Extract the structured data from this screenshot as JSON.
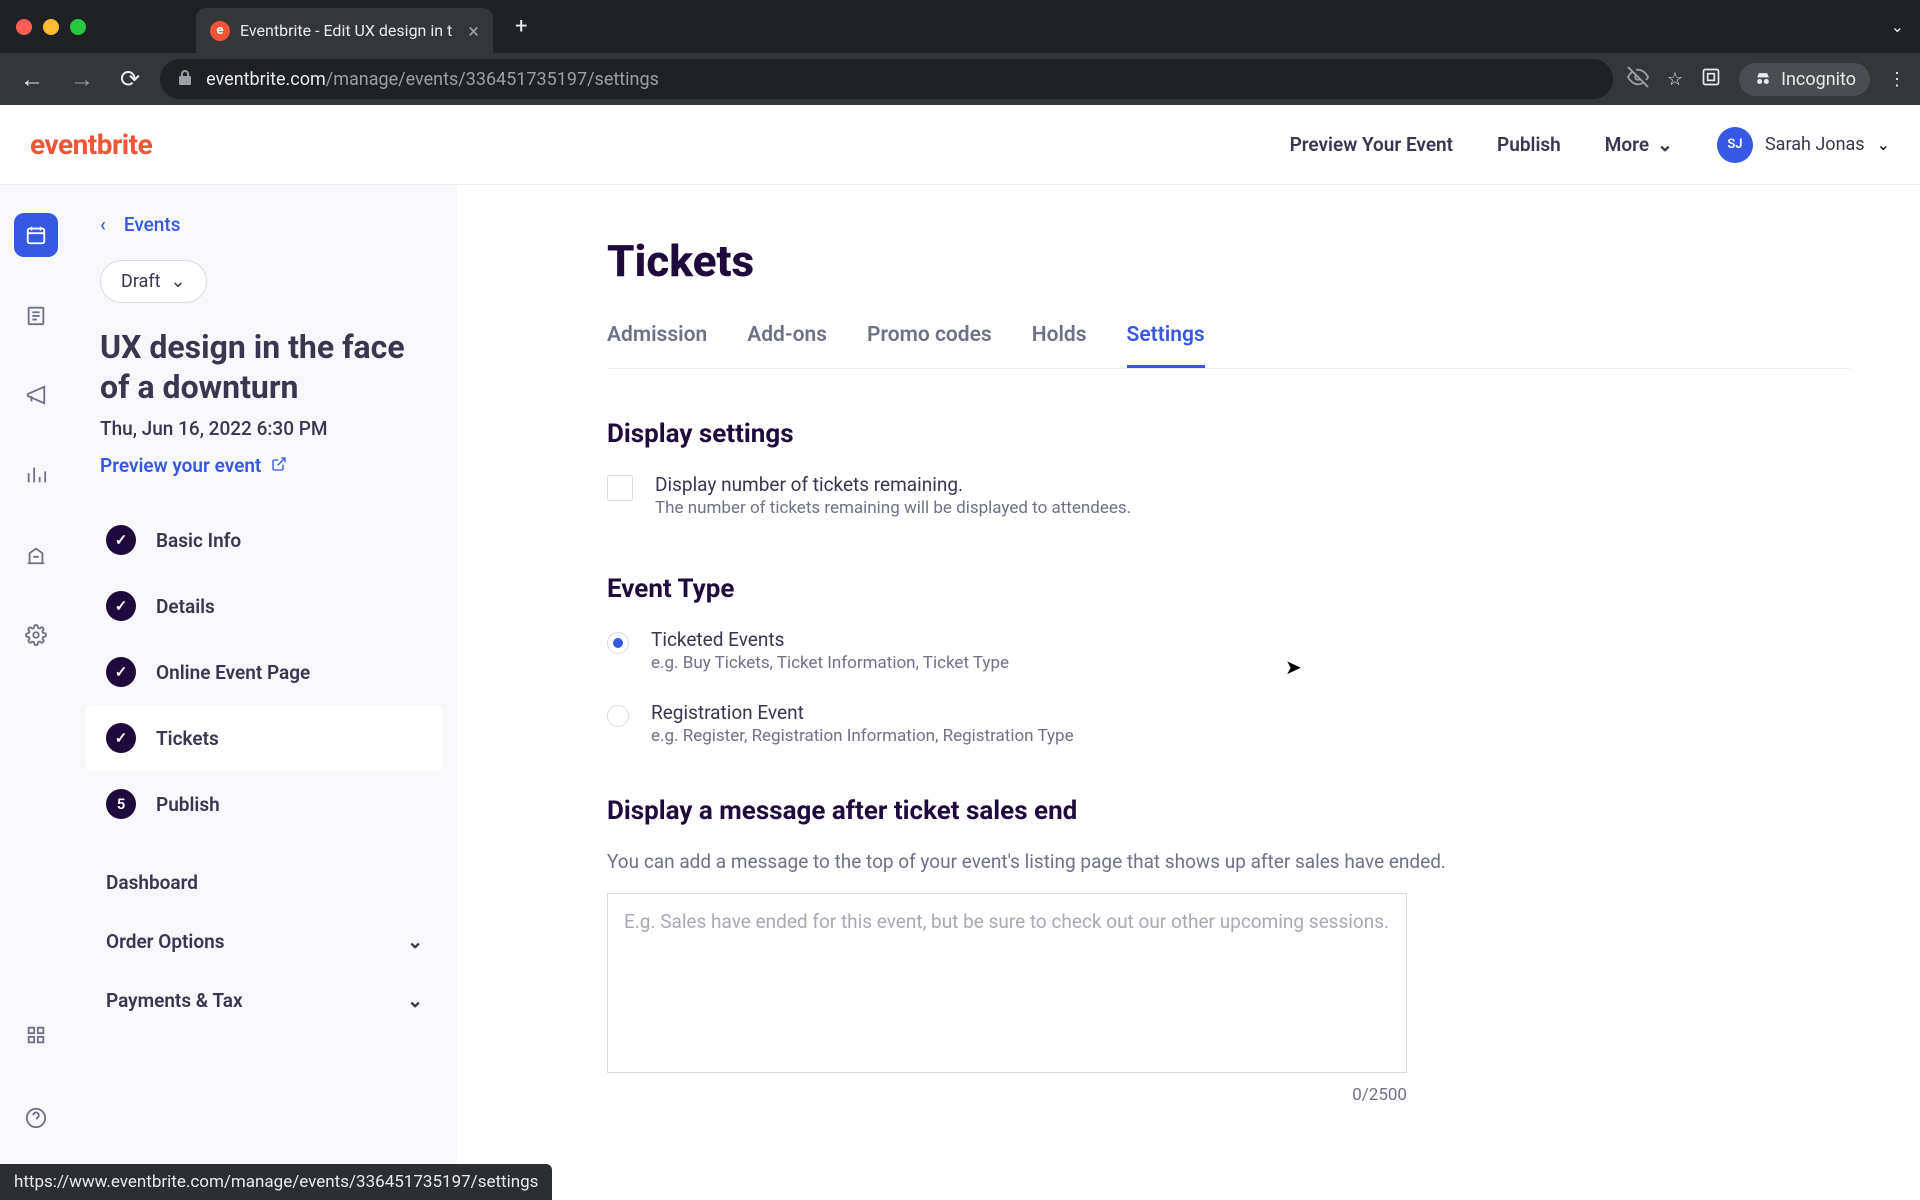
{
  "browser": {
    "tab_title": "Eventbrite - Edit UX design in t",
    "url_host": "eventbrite.com",
    "url_path": "/manage/events/336451735197/settings",
    "incognito_label": "Incognito"
  },
  "header": {
    "logo": "eventbrite",
    "preview_event": "Preview Your Event",
    "publish": "Publish",
    "more": "More",
    "user_initials": "SJ",
    "user_name": "Sarah Jonas"
  },
  "sidebar": {
    "back_label": "Events",
    "status_pill": "Draft",
    "event_title": "UX design in the face of a downturn",
    "event_date": "Thu, Jun 16, 2022 6:30 PM",
    "preview_link": "Preview your event",
    "steps": [
      {
        "label": "Basic Info",
        "done": true
      },
      {
        "label": "Details",
        "done": true
      },
      {
        "label": "Online Event Page",
        "done": true
      },
      {
        "label": "Tickets",
        "done": true,
        "active": true
      },
      {
        "label": "Publish",
        "num": "5"
      }
    ],
    "links": {
      "dashboard": "Dashboard",
      "order_options": "Order Options",
      "payments_tax": "Payments & Tax"
    }
  },
  "content": {
    "title": "Tickets",
    "tabs": {
      "admission": "Admission",
      "addons": "Add-ons",
      "promo": "Promo codes",
      "holds": "Holds",
      "settings": "Settings"
    },
    "display_settings_title": "Display settings",
    "display_remaining_label": "Display number of tickets remaining.",
    "display_remaining_sub": "The number of tickets remaining will be displayed to attendees.",
    "event_type_title": "Event Type",
    "ticketed_label": "Ticketed Events",
    "ticketed_sub": "e.g. Buy Tickets, Ticket Information, Ticket Type",
    "registration_label": "Registration Event",
    "registration_sub": "e.g. Register, Registration Information, Registration Type",
    "message_title": "Display a message after ticket sales end",
    "message_desc": "You can add a message to the top of your event's listing page that shows up after sales have ended.",
    "message_placeholder": "E.g. Sales have ended for this event, but be sure to check out our other upcoming sessions.",
    "char_count": "0/2500"
  },
  "status_url": "https://www.eventbrite.com/manage/events/336451735197/settings"
}
